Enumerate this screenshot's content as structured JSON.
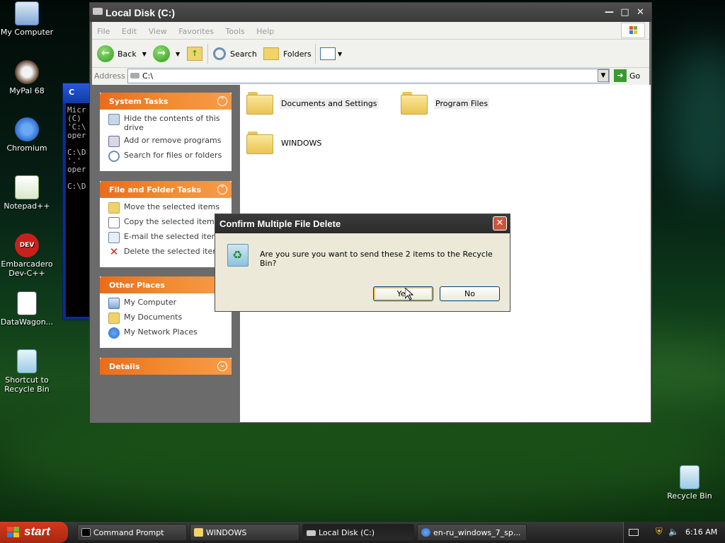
{
  "desktop": {
    "icons": [
      {
        "label": "My Computer"
      },
      {
        "label": "MyPal 68"
      },
      {
        "label": "Chromium"
      },
      {
        "label": "Notepad++"
      },
      {
        "label": "Embarcadero Dev-C++"
      },
      {
        "label": "DataWagon..."
      },
      {
        "label": "Shortcut to Recycle Bin"
      },
      {
        "label": "Recycle Bin"
      }
    ]
  },
  "console": {
    "title": "C",
    "lines": "Micr\n(C)\n'C:\\\noper\n\nC:\\D\n'.'\noper\n\nC:\\D"
  },
  "explorer": {
    "title": "Local Disk (C:)",
    "menu": [
      "File",
      "Edit",
      "View",
      "Favorites",
      "Tools",
      "Help"
    ],
    "toolbar": {
      "back": "Back",
      "search": "Search",
      "folders": "Folders"
    },
    "address": {
      "label": "Address",
      "value": "C:\\",
      "go": "Go"
    },
    "panels": {
      "system_tasks": {
        "title": "System Tasks",
        "items": [
          "Hide the contents of this drive",
          "Add or remove programs",
          "Search for files or folders"
        ]
      },
      "file_folder_tasks": {
        "title": "File and Folder Tasks",
        "items": [
          "Move the selected items",
          "Copy the selected items",
          "E-mail the selected items",
          "Delete the selected items"
        ]
      },
      "other_places": {
        "title": "Other Places",
        "items": [
          "My Computer",
          "My Documents",
          "My Network Places"
        ]
      },
      "details": {
        "title": "Details"
      }
    },
    "files": [
      "Documents and Settings",
      "Program Files",
      "WINDOWS"
    ]
  },
  "dialog": {
    "title": "Confirm Multiple File Delete",
    "message": "Are you sure you want to send these 2 items to the Recycle Bin?",
    "yes": "Yes",
    "no": "No"
  },
  "taskbar": {
    "start": "start",
    "items": [
      "Command Prompt",
      "WINDOWS",
      "Local Disk (C:)",
      "en-ru_windows_7_sp..."
    ],
    "clock": "6:16 AM"
  }
}
